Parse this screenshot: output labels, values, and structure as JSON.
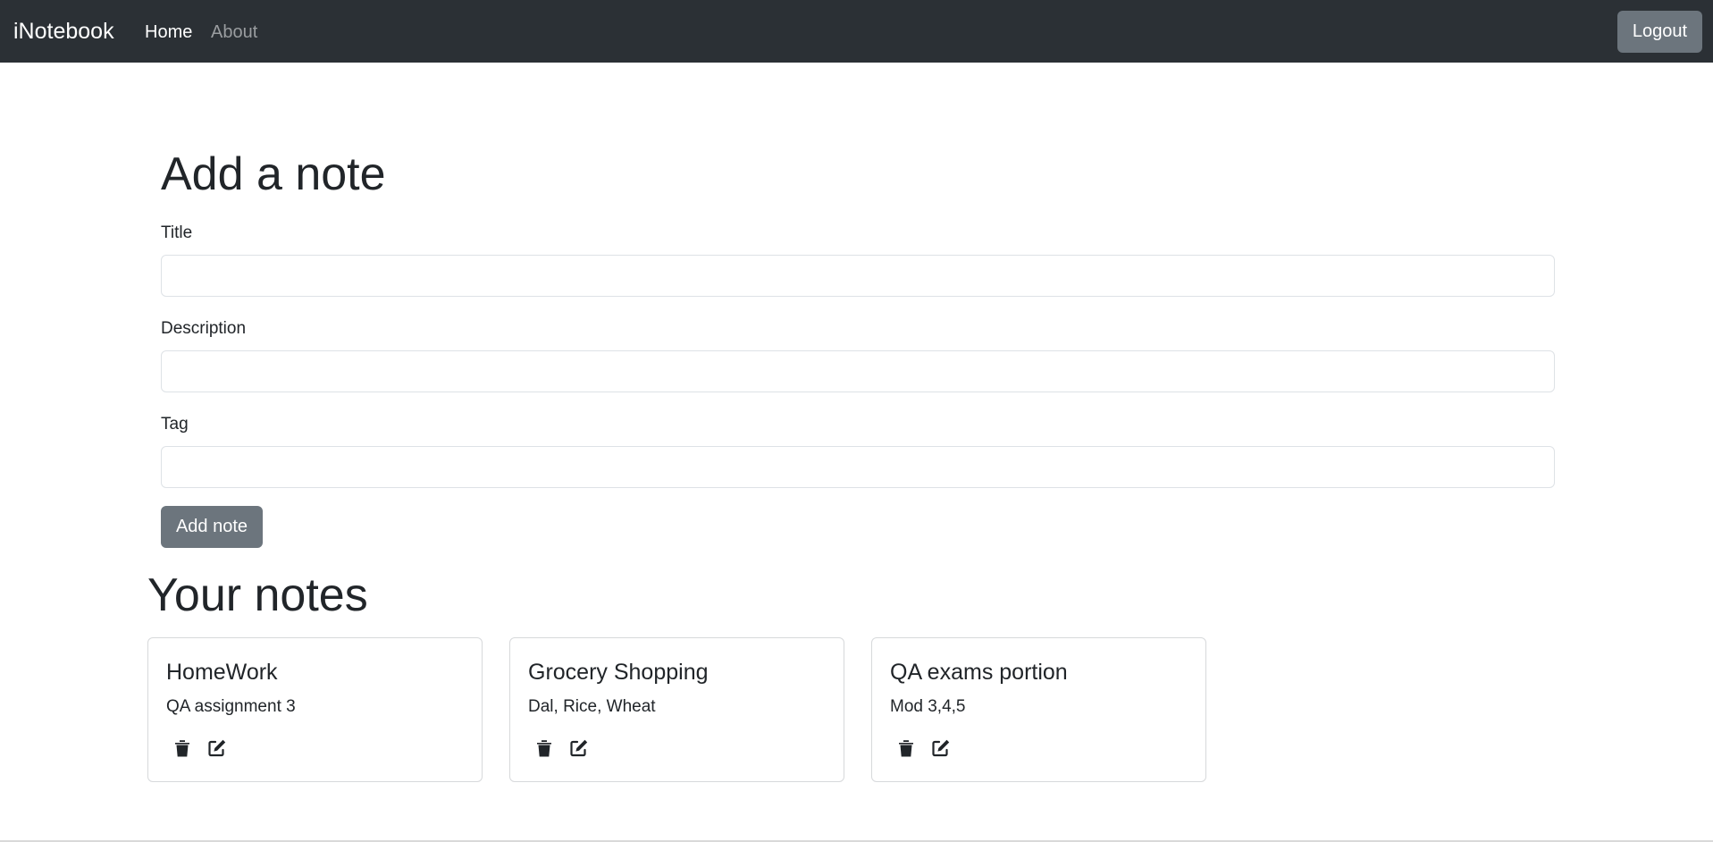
{
  "navbar": {
    "brand": "iNotebook",
    "links": [
      {
        "label": "Home",
        "active": true
      },
      {
        "label": "About",
        "active": false
      }
    ],
    "logout_label": "Logout"
  },
  "form": {
    "heading": "Add a note",
    "fields": [
      {
        "label": "Title",
        "value": ""
      },
      {
        "label": "Description",
        "value": ""
      },
      {
        "label": "Tag",
        "value": ""
      }
    ],
    "submit_label": "Add note"
  },
  "notes_section": {
    "heading": "Your notes",
    "notes": [
      {
        "title": "HomeWork",
        "description": "QA assignment 3",
        "icons": [
          "trash-icon",
          "edit-icon"
        ]
      },
      {
        "title": "Grocery Shopping",
        "description": "Dal, Rice, Wheat",
        "icons": [
          "trash-icon",
          "edit-icon"
        ]
      },
      {
        "title": "QA exams portion",
        "description": "Mod 3,4,5",
        "icons": [
          "trash-icon",
          "edit-icon"
        ]
      }
    ]
  },
  "colors": {
    "navbar_bg": "#2b3035",
    "button_bg": "#6c757d",
    "text": "#212529",
    "nav_inactive": "#9a9da0",
    "border": "#dee2e6"
  }
}
